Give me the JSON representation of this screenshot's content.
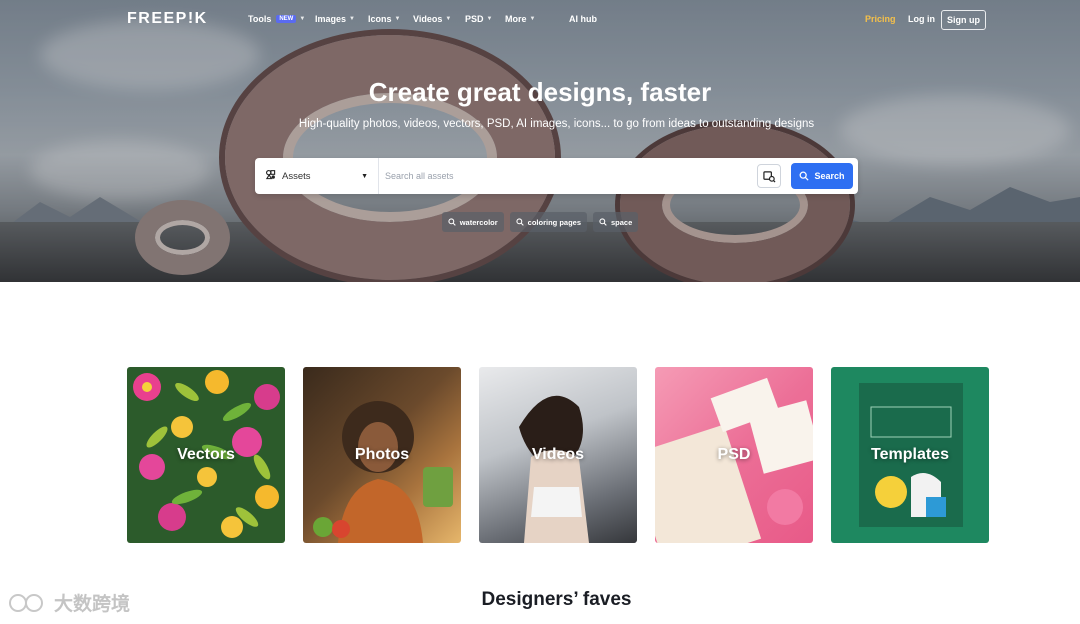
{
  "nav": {
    "logo": "FREEP!K",
    "items": [
      {
        "label": "Tools",
        "badge": "NEW",
        "has_chevron": true
      },
      {
        "label": "Images",
        "has_chevron": true
      },
      {
        "label": "Icons",
        "has_chevron": true
      },
      {
        "label": "Videos",
        "has_chevron": true
      },
      {
        "label": "PSD",
        "has_chevron": true
      },
      {
        "label": "More",
        "has_chevron": true
      },
      {
        "label": "AI hub",
        "has_chevron": false
      }
    ],
    "pricing": "Pricing",
    "login": "Log in",
    "signup": "Sign up"
  },
  "hero": {
    "title": "Create great designs, faster",
    "subtitle": "High-quality photos, videos, vectors, PSD, AI images, icons... to go from ideas to outstanding designs"
  },
  "search": {
    "type_label": "Assets",
    "placeholder": "Search all assets",
    "value": "",
    "button_label": "Search"
  },
  "tags": [
    "watercolor",
    "coloring pages",
    "space"
  ],
  "categories": [
    {
      "label": "Vectors"
    },
    {
      "label": "Photos"
    },
    {
      "label": "Videos"
    },
    {
      "label": "PSD"
    },
    {
      "label": "Templates"
    }
  ],
  "section": {
    "title": "Designers’ faves"
  },
  "watermark": {
    "text": "大数跨境"
  },
  "colors": {
    "accent_blue": "#2e6ff2",
    "pricing_yellow": "#f5c04a",
    "templates_green": "#1e8860"
  }
}
